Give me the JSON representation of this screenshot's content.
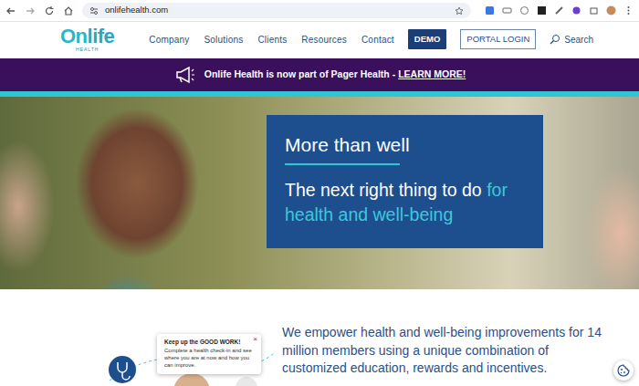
{
  "browser": {
    "url": "onlifehealth.com"
  },
  "logo": {
    "first": "On",
    "second": "life",
    "sub": "HEALTH"
  },
  "nav": {
    "links": [
      {
        "label": "Company"
      },
      {
        "label": "Solutions"
      },
      {
        "label": "Clients"
      },
      {
        "label": "Resources"
      },
      {
        "label": "Contact"
      }
    ],
    "demo": "DEMO",
    "portal": "PORTAL LOGIN",
    "search": "Search"
  },
  "banner": {
    "text": "Onlife Health is now part of Pager Health -",
    "link": "LEARN MORE!"
  },
  "hero": {
    "title": "More than well",
    "line_plain": "The next right thing to do",
    "line_accent": "for health and well-being"
  },
  "intro": {
    "text": "We empower health and well-being improvements for 14 million members using a unique combination of customized education, rewards and incentives."
  },
  "tooltip": {
    "title": "Keep up the GOOD WORK!",
    "body": "Complete a health check-in and see where you are at now and how you can improve.",
    "close": "×"
  }
}
